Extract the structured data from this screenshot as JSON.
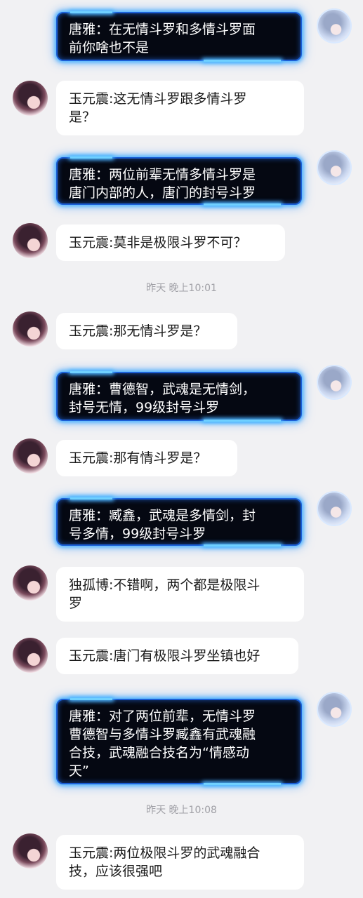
{
  "messages": [
    {
      "type": "out",
      "lines": [
        "唐雅：在无情斗罗和多情斗罗面",
        "前你啥也不是"
      ]
    },
    {
      "type": "in",
      "lines": [
        "玉元震:这无情斗罗跟多情斗罗",
        "是？"
      ]
    },
    {
      "type": "out",
      "lines": [
        "唐雅：两位前辈无情多情斗罗是",
        "唐门内部的人，唐门的封号斗罗"
      ]
    },
    {
      "type": "in",
      "lines": [
        "玉元震:莫非是极限斗罗不可？"
      ]
    },
    {
      "type": "time",
      "text": "昨天 晚上10:01"
    },
    {
      "type": "in",
      "lines": [
        "玉元震:那无情斗罗是？"
      ]
    },
    {
      "type": "out",
      "lines": [
        "唐雅：曹德智，武魂是无情剑，",
        "封号无情，99级封号斗罗"
      ]
    },
    {
      "type": "in",
      "lines": [
        "玉元震:那有情斗罗是？"
      ]
    },
    {
      "type": "out",
      "lines": [
        "唐雅：臧鑫，武魂是多情剑，封",
        "号多情，99级封号斗罗"
      ]
    },
    {
      "type": "in",
      "lines": [
        "独孤博:不错啊，两个都是极限斗",
        "罗"
      ]
    },
    {
      "type": "in",
      "lines": [
        "玉元震:唐门有极限斗罗坐镇也好"
      ]
    },
    {
      "type": "out",
      "lines": [
        "唐雅：对了两位前辈，无情斗罗",
        "曹德智与多情斗罗臧鑫有武魂融",
        "合技，武魂融合技名为“情感动",
        "天”"
      ]
    },
    {
      "type": "time",
      "text": "昨天 晚上10:08"
    },
    {
      "type": "in",
      "lines": [
        "玉元震:两位极限斗罗的武魂融合",
        "技，应该很强吧"
      ]
    }
  ]
}
